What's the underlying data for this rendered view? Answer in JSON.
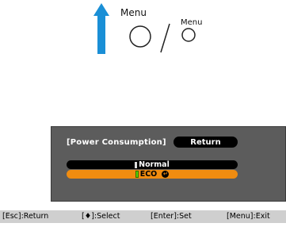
{
  "instruction": {
    "menu_label_large": "Menu",
    "menu_label_small": "Menu",
    "separator": "/"
  },
  "osd": {
    "title": "[Power Consumption]",
    "return_label": "Return",
    "options": [
      {
        "label": "Normal",
        "selected": false
      },
      {
        "label": "ECO",
        "selected": true
      }
    ],
    "colors": {
      "panel": "#5c5c5c",
      "highlight": "#f08c10",
      "active_marker": "#5dd000",
      "arrow": "#1a8fd6"
    }
  },
  "statusbar": {
    "esc": "[Esc]:Return",
    "select": "[♦]:Select",
    "enter": "[Enter]:Set",
    "menu": "[Menu]:Exit"
  }
}
